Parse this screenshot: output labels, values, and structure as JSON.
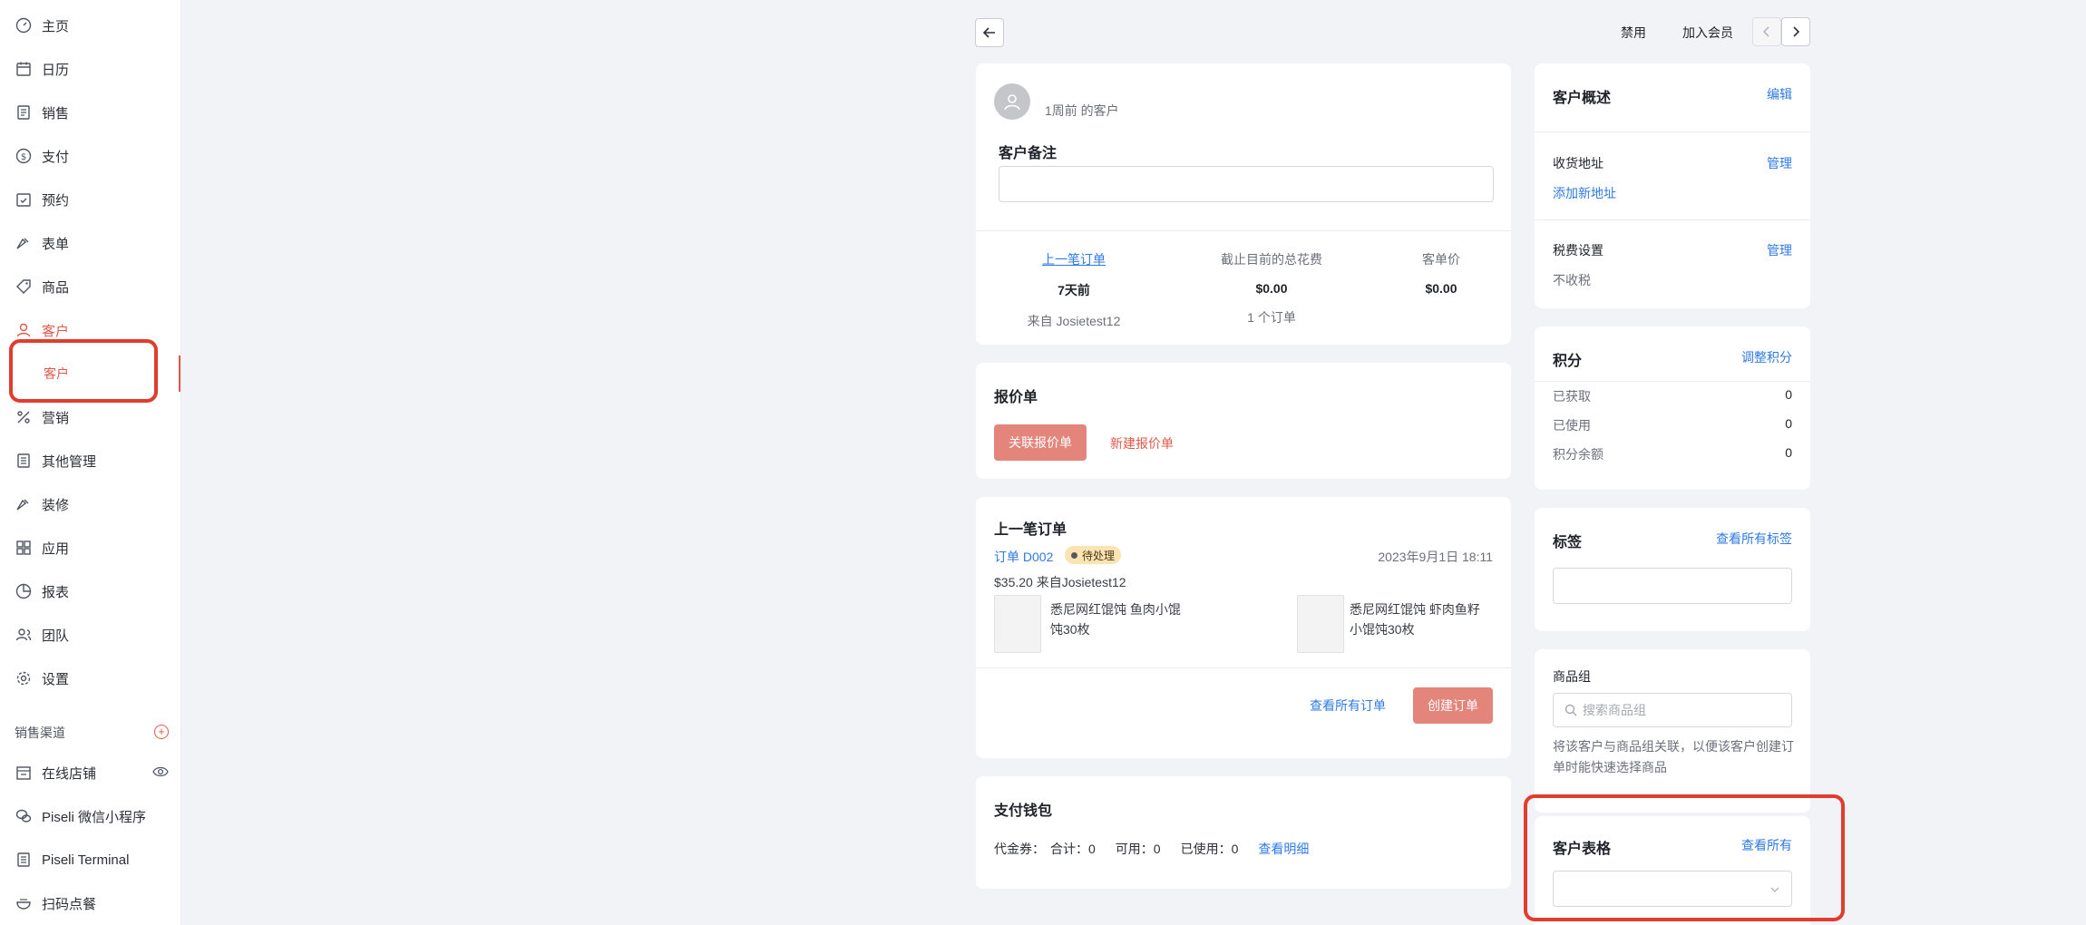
{
  "sidebar": {
    "items": [
      {
        "label": "主页"
      },
      {
        "label": "日历"
      },
      {
        "label": "销售"
      },
      {
        "label": "支付"
      },
      {
        "label": "预约"
      },
      {
        "label": "表单"
      },
      {
        "label": "商品"
      },
      {
        "label": "客户"
      },
      {
        "label": "营销"
      },
      {
        "label": "其他管理"
      },
      {
        "label": "装修"
      },
      {
        "label": "应用"
      },
      {
        "label": "报表"
      },
      {
        "label": "团队"
      },
      {
        "label": "设置"
      }
    ],
    "sub_active": "客户",
    "channels_title": "销售渠道",
    "channels": [
      {
        "label": "在线店铺"
      },
      {
        "label": "Piseli 微信小程序"
      },
      {
        "label": "Piseli Terminal"
      },
      {
        "label": "扫码点餐"
      }
    ]
  },
  "topbar": {
    "disable_label": "禁用",
    "join_member_label": "加入会员"
  },
  "customer": {
    "since": "1周前 的客户",
    "note_title": "客户备注",
    "stats": [
      {
        "label": "上一笔订单",
        "value": "7天前",
        "sub": "来自 Josietest12"
      },
      {
        "label": "截止目前的总花费",
        "value": "$0.00",
        "sub": "1 个订单"
      },
      {
        "label": "客单价",
        "value": "$0.00",
        "sub": ""
      }
    ]
  },
  "quote": {
    "title": "报价单",
    "link_btn": "关联报价单",
    "new_btn": "新建报价单"
  },
  "last_order": {
    "title": "上一笔订单",
    "order_no": "订单 D002",
    "status": "待处理",
    "date": "2023年9月1日 18:11",
    "summary": "$35.20 来自Josietest12",
    "items": [
      {
        "name": "悉尼网红馄饨 鱼肉小馄饨30枚"
      },
      {
        "name": "悉尼网红馄饨 虾肉鱼籽小馄饨30枚"
      }
    ],
    "view_all": "查看所有订单",
    "create": "创建订单"
  },
  "wallet": {
    "title": "支付钱包",
    "voucher_label": "代金券：",
    "total": "合计：0",
    "available": "可用：0",
    "used": "已使用：0",
    "detail_link": "查看明细"
  },
  "overview": {
    "title": "客户概述",
    "edit": "编辑",
    "address_title": "收货地址",
    "address_manage": "管理",
    "add_address": "添加新地址",
    "tax_title": "税费设置",
    "tax_manage": "管理",
    "tax_value": "不收税"
  },
  "points": {
    "title": "积分",
    "adjust": "调整积分",
    "rows": [
      {
        "label": "已获取",
        "value": "0"
      },
      {
        "label": "已使用",
        "value": "0"
      },
      {
        "label": "积分余额",
        "value": "0"
      }
    ]
  },
  "tags": {
    "title": "标签",
    "view_all": "查看所有标签"
  },
  "product_group": {
    "title": "商品组",
    "placeholder": "搜索商品组",
    "desc": "将该客户与商品组关联，以便该客户创建订单时能快速选择商品"
  },
  "customer_form": {
    "title": "客户表格",
    "view_all": "查看所有"
  },
  "colors": {
    "accent": "#e0594a",
    "link": "#2f7ae5",
    "highlight": "#e23d2c"
  }
}
